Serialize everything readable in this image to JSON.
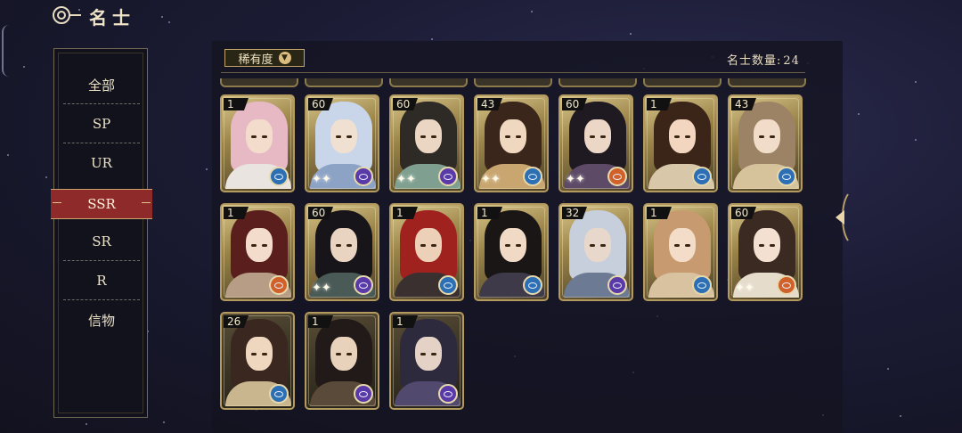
{
  "header": {
    "title": "名士"
  },
  "sidebar": {
    "items": [
      {
        "label": "全部",
        "active": false
      },
      {
        "label": "SP",
        "active": false
      },
      {
        "label": "UR",
        "active": false
      },
      {
        "label": "SSR",
        "active": true
      },
      {
        "label": "SR",
        "active": false
      },
      {
        "label": "R",
        "active": false
      },
      {
        "label": "信物",
        "active": false
      }
    ]
  },
  "toolbar": {
    "sort_label": "稀有度",
    "count_label": "名士数量:",
    "count_value": "24"
  },
  "cards": [
    {
      "level": "1",
      "hair": "#e7b9c4",
      "skin": "#f3dccc",
      "robe": "#e9e4e0",
      "element": "blue",
      "sparkle": false
    },
    {
      "level": "60",
      "hair": "#c9d6ea",
      "skin": "#efe0d2",
      "robe": "#8da3c6",
      "element": "purple",
      "sparkle": true
    },
    {
      "level": "60",
      "hair": "#2e2a26",
      "skin": "#ead6c2",
      "robe": "#7fa090",
      "element": "purple",
      "sparkle": true
    },
    {
      "level": "43",
      "hair": "#3a261a",
      "skin": "#f0d8c0",
      "robe": "#c9a670",
      "element": "blue",
      "sparkle": true
    },
    {
      "level": "60",
      "hair": "#1f1a22",
      "skin": "#ecd6c6",
      "robe": "#5d4a66",
      "element": "orange",
      "sparkle": true
    },
    {
      "level": "1",
      "hair": "#3b2418",
      "skin": "#f2d6c0",
      "robe": "#d8c7a8",
      "element": "blue",
      "sparkle": false
    },
    {
      "level": "43",
      "hair": "#9c8366",
      "skin": "#f0dcc8",
      "robe": "#d6c39c",
      "element": "blue",
      "sparkle": false
    },
    {
      "level": "1",
      "hair": "#5a1e1c",
      "skin": "#f3dccc",
      "robe": "#b79c86",
      "element": "orange",
      "sparkle": false
    },
    {
      "level": "60",
      "hair": "#17151a",
      "skin": "#e8d4c0",
      "robe": "#4a5a56",
      "element": "purple",
      "sparkle": true
    },
    {
      "level": "1",
      "hair": "#a0221e",
      "skin": "#ecd0b8",
      "robe": "#3b3030",
      "element": "blue",
      "sparkle": false
    },
    {
      "level": "1",
      "hair": "#1a1616",
      "skin": "#f0dac6",
      "robe": "#3e3a4a",
      "element": "blue",
      "sparkle": false
    },
    {
      "level": "32",
      "hair": "#c7cfdc",
      "skin": "#e8d8cc",
      "robe": "#6c7a94",
      "element": "purple",
      "sparkle": false
    },
    {
      "level": "1",
      "hair": "#c89a70",
      "skin": "#f3dcc8",
      "robe": "#d9c2a0",
      "element": "blue",
      "sparkle": false
    },
    {
      "level": "60",
      "hair": "#3a2a22",
      "skin": "#f4e0d0",
      "robe": "#e6dccc",
      "element": "orange",
      "sparkle": true
    },
    {
      "level": "26",
      "hair": "#3a2820",
      "skin": "#eed6bf",
      "robe": "#c9b68e",
      "element": "blue",
      "sparkle": false
    },
    {
      "level": "1",
      "hair": "#221a18",
      "skin": "#e8d2bc",
      "robe": "#5a4a3a",
      "element": "purple",
      "sparkle": false
    },
    {
      "level": "1",
      "hair": "#2e2a3e",
      "skin": "#e4d2c6",
      "robe": "#514a6e",
      "element": "purple",
      "sparkle": false
    }
  ],
  "colors": {
    "accent_red": "#8e2a2a",
    "gold": "#c2a56a",
    "orb_blue": "#2c6fb4",
    "orb_purple": "#5a3aa8",
    "orb_orange": "#d0612a"
  }
}
